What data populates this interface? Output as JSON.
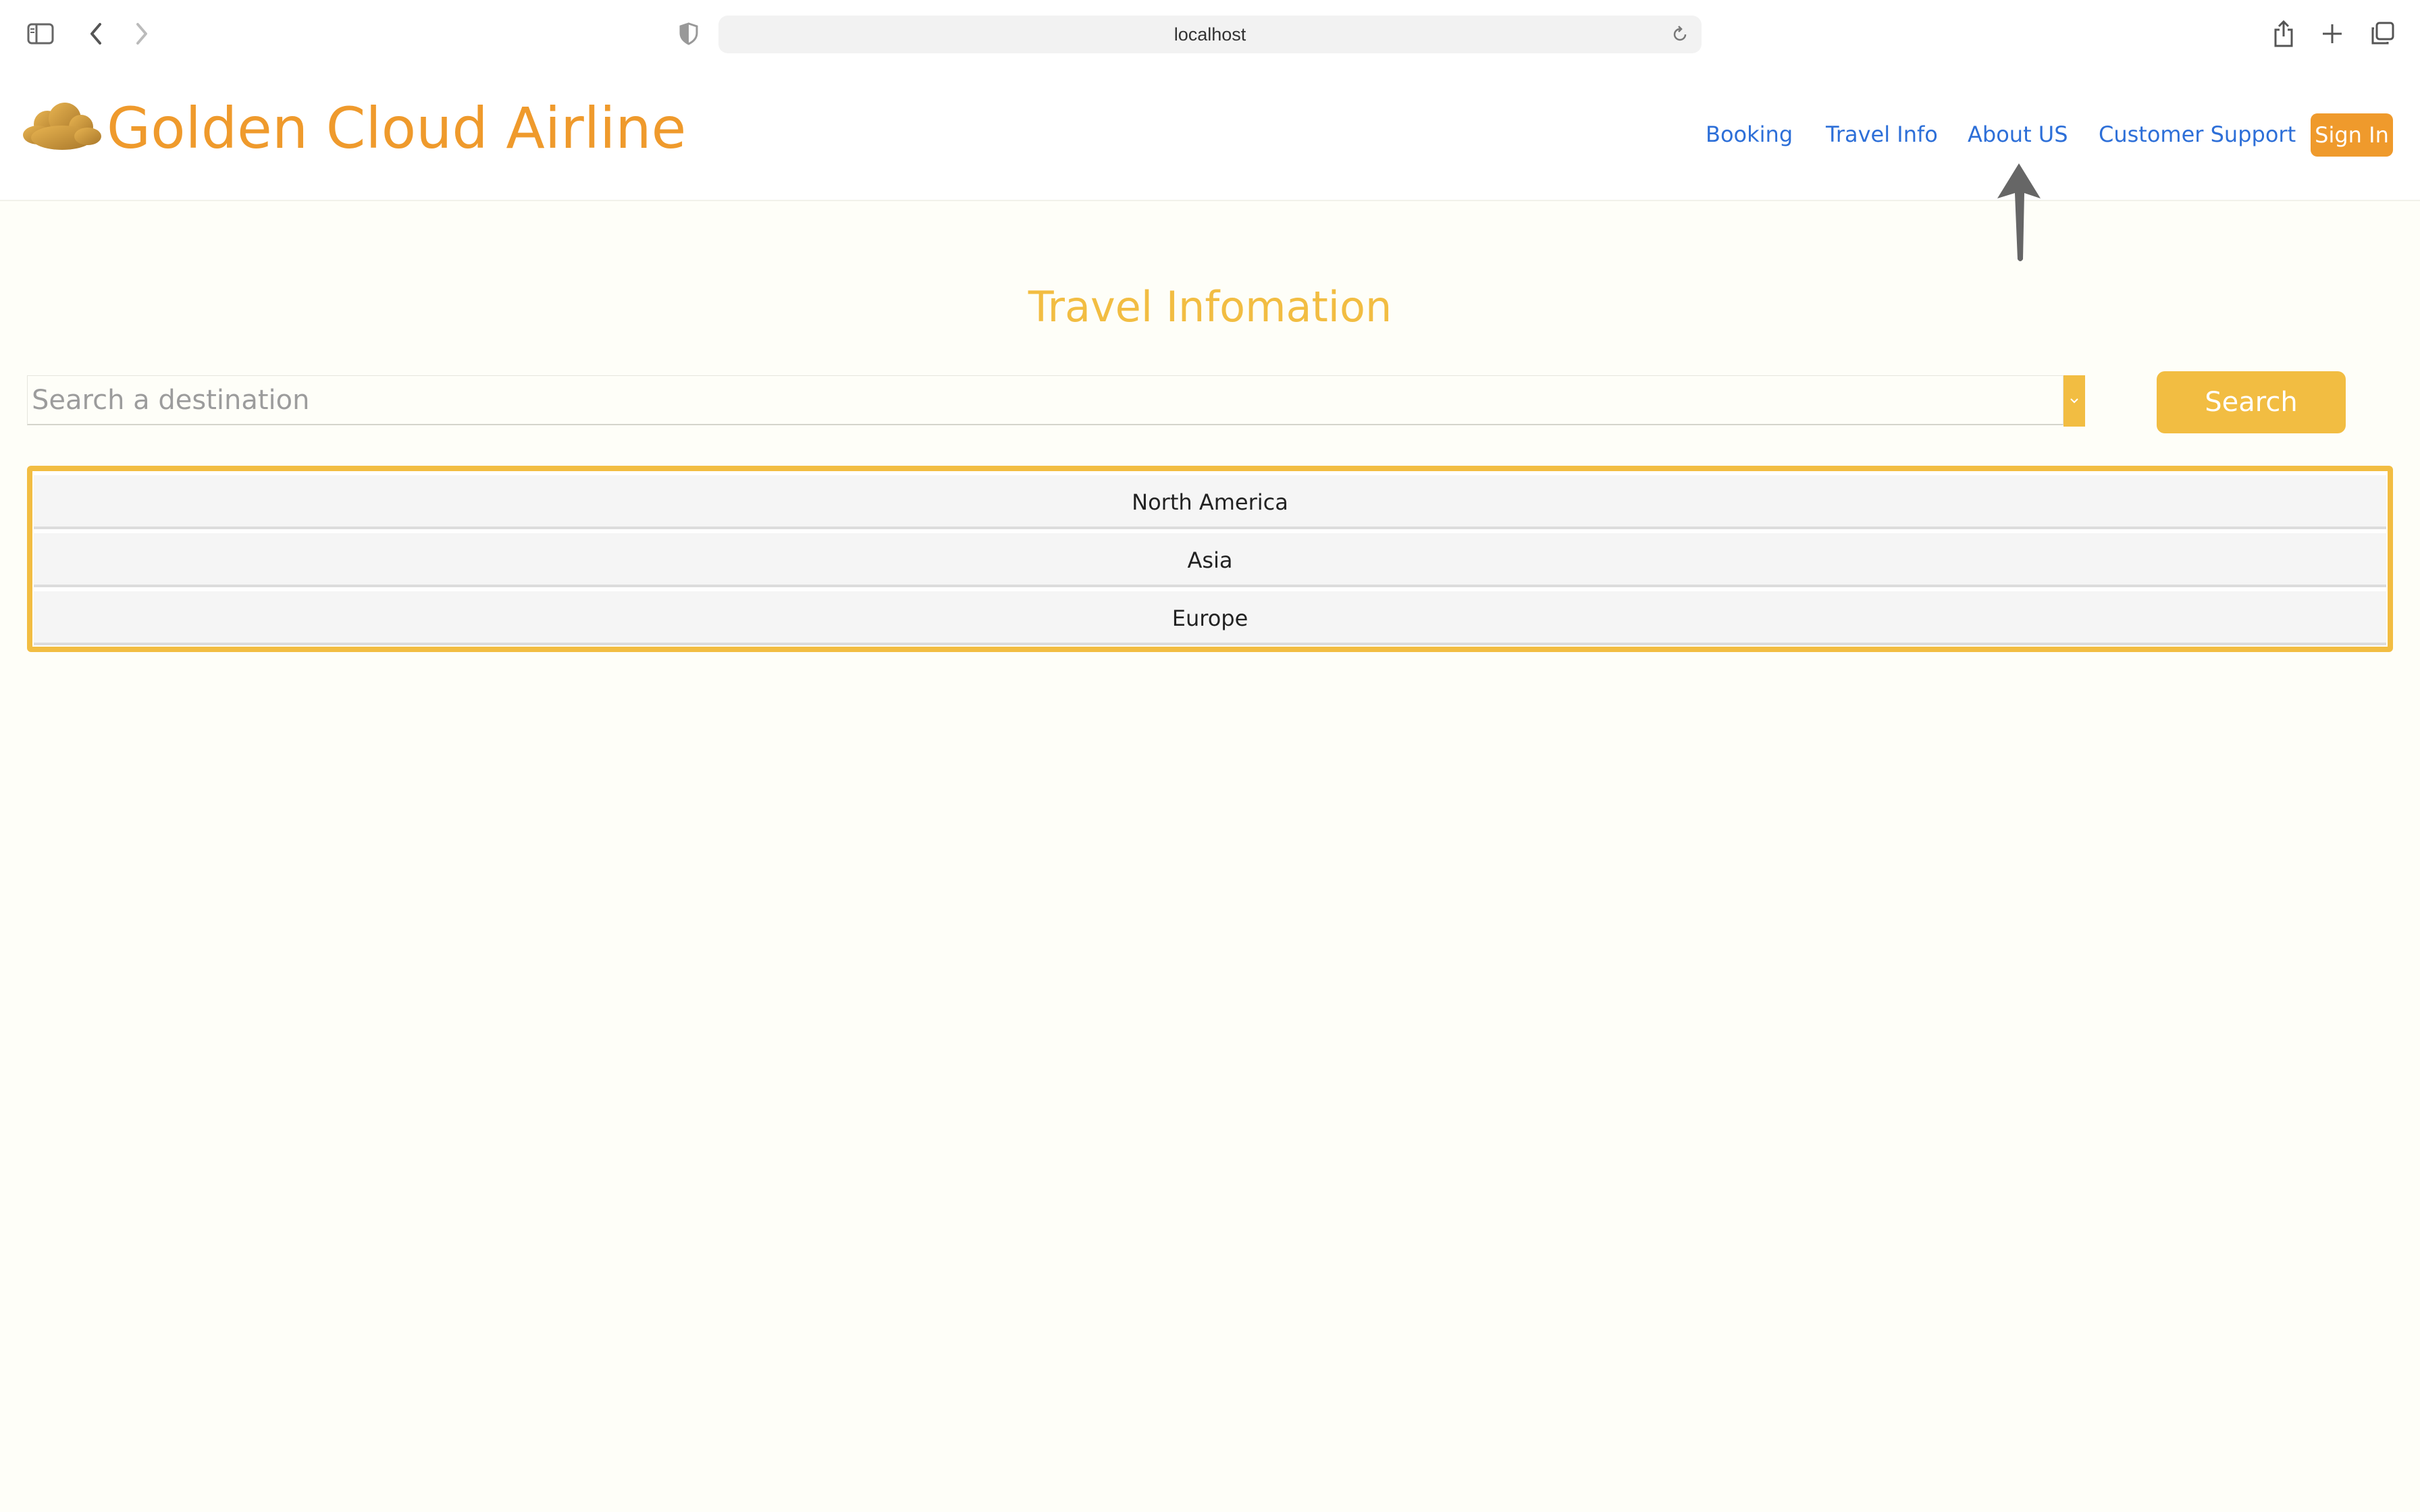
{
  "browser": {
    "url": "localhost",
    "icons": [
      "sidebar-icon",
      "back-icon",
      "forward-icon",
      "shield-icon",
      "reload-icon",
      "share-icon",
      "new-tab-icon",
      "tab-overview-icon"
    ]
  },
  "header": {
    "brand": "Golden Cloud Airline",
    "logo_icon": "cloud-icon",
    "nav": {
      "booking": "Booking",
      "travel_info": "Travel Info",
      "about_us": "About US",
      "customer_support": "Customer Support"
    },
    "sign_in": "Sign In"
  },
  "main": {
    "title": "Travel Infomation",
    "search": {
      "placeholder": "Search a destination",
      "value": "",
      "button_label": "Search"
    },
    "regions": [
      "North America",
      "Asia",
      "Europe"
    ]
  },
  "colors": {
    "brand_orange": "#ef9a2c",
    "accent_yellow": "#f2bd42",
    "link_blue": "#2d6fd8",
    "page_background": "#fefef8"
  }
}
